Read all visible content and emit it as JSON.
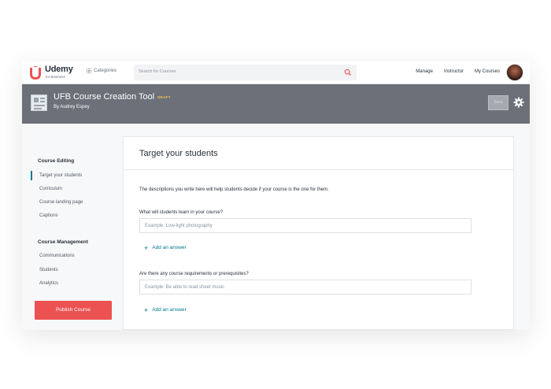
{
  "app": {
    "logo": "Udemy",
    "logo_sub": "for Business"
  },
  "nav": {
    "categories": "Categories",
    "search_placeholder": "Search for Courses",
    "links": [
      "Manage",
      "Instructor",
      "My Courses"
    ]
  },
  "course": {
    "title": "UFB Course Creation Tool",
    "status": "DRAFT",
    "author": "By Audrey Espey",
    "save_label": "Save"
  },
  "sidebar": {
    "sections": [
      {
        "heading": "Course Editing",
        "items": [
          "Target your students",
          "Curriculum",
          "Course landing page",
          "Captions"
        ]
      },
      {
        "heading": "Course Management",
        "items": [
          "Communications",
          "Students",
          "Analytics"
        ]
      }
    ],
    "publish_label": "Publish Course"
  },
  "main": {
    "title": "Target your students",
    "description": "The descriptions you write here will help students decide if your course is the one for them.",
    "questions": [
      {
        "label": "What will students learn in your course?",
        "placeholder": "Example: Low-light photography",
        "add_label": "Add an answer"
      },
      {
        "label": "Are there any course requirements or prerequisites?",
        "placeholder": "Example: Be able to read sheet music",
        "add_label": "Add an answer"
      }
    ]
  },
  "colors": {
    "brand": "#ec5252",
    "accent": "#007791",
    "header_bg": "#6b7079"
  }
}
